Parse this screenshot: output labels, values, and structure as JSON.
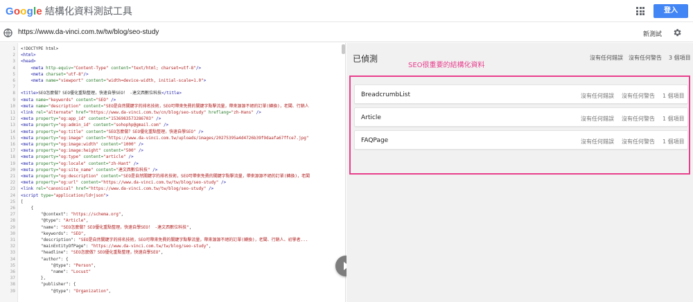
{
  "header": {
    "google_letters": [
      "G",
      "o",
      "o",
      "g",
      "l",
      "e"
    ],
    "tool_name": "結構化資料測試工具",
    "apps_icon": "apps-grid-icon",
    "signin_label": "登入"
  },
  "urlbar": {
    "globe_icon": "globe-icon",
    "url": "https://www.da-vinci.com.tw/tw/blog/seo-study",
    "new_test_label": "新測試",
    "settings_icon": "gear-icon"
  },
  "editor": {
    "lines": [
      {
        "n": "1",
        "parts": [
          [
            "p",
            "<!DOCTYPE html>"
          ]
        ]
      },
      {
        "n": "2",
        "parts": [
          [
            "t",
            "<html>"
          ]
        ]
      },
      {
        "n": "3",
        "parts": [
          [
            "t",
            "<head>"
          ]
        ]
      },
      {
        "n": "4",
        "parts": [
          [
            "p",
            "    "
          ],
          [
            "t",
            "<meta "
          ],
          [
            "a",
            "http-equiv="
          ],
          [
            "s",
            "\"Content-Type\""
          ],
          [
            "a",
            " content="
          ],
          [
            "s",
            "\"text/html; charset=utf-8\""
          ],
          [
            "t",
            "/>"
          ]
        ]
      },
      {
        "n": "5",
        "parts": [
          [
            "p",
            "    "
          ],
          [
            "t",
            "<meta "
          ],
          [
            "a",
            "charset="
          ],
          [
            "s",
            "\"utf-8\""
          ],
          [
            "t",
            "/>"
          ]
        ]
      },
      {
        "n": "6",
        "parts": [
          [
            "p",
            "    "
          ],
          [
            "t",
            "<meta "
          ],
          [
            "a",
            "name="
          ],
          [
            "s",
            "\"viewport\""
          ],
          [
            "a",
            " content="
          ],
          [
            "s",
            "\"width=device-width, initial-scale=1.0\""
          ],
          [
            "t",
            ">"
          ]
        ]
      },
      {
        "n": "7",
        "parts": [
          [
            "p",
            ""
          ]
        ]
      },
      {
        "n": "8",
        "parts": [
          [
            "t",
            "<title>"
          ],
          [
            "p",
            "SEO怎麼做？SEO優化重點整理，快速自學SEO！ -達文西數位科技"
          ],
          [
            "t",
            "</title>"
          ]
        ]
      },
      {
        "n": "9",
        "parts": [
          [
            "t",
            "<meta "
          ],
          [
            "a",
            "name="
          ],
          [
            "s",
            "\"keywords\""
          ],
          [
            "a",
            " content="
          ],
          [
            "s",
            "\"SEO\""
          ],
          [
            "t",
            " />"
          ]
        ]
      },
      {
        "n": "10",
        "parts": [
          [
            "t",
            "<meta "
          ],
          [
            "a",
            "name="
          ],
          [
            "s",
            "\"description\""
          ],
          [
            "a",
            " content="
          ],
          [
            "s",
            "\"SEO是自然關鍵字的排名技術，SEO可帶來免費的關鍵字點擊流量，帶來源源不絕的訂單(轉換)，老闆、行銷人"
          ]
        ]
      },
      {
        "n": "11",
        "parts": [
          [
            "t",
            "<link "
          ],
          [
            "a",
            "rel="
          ],
          [
            "s",
            "\"alternate\""
          ],
          [
            "a",
            " href="
          ],
          [
            "s",
            "\"https://www.da-vinci.com.tw/cn/blog/seo-study\""
          ],
          [
            "a",
            " hreflang="
          ],
          [
            "s",
            "\"zh-Hans\""
          ],
          [
            "t",
            " />"
          ]
        ]
      },
      {
        "n": "12",
        "parts": [
          [
            "t",
            "<meta "
          ],
          [
            "a",
            "property="
          ],
          [
            "s",
            "\"og:app_id\""
          ],
          [
            "a",
            " content="
          ],
          [
            "s",
            "\"1536983573286703\""
          ],
          [
            "t",
            " />"
          ]
        ]
      },
      {
        "n": "13",
        "parts": [
          [
            "t",
            "<meta "
          ],
          [
            "a",
            "property="
          ],
          [
            "s",
            "\"og:admin_id\""
          ],
          [
            "a",
            " content="
          ],
          [
            "s",
            "\"sohophp@gmail.com\""
          ],
          [
            "t",
            " />"
          ]
        ]
      },
      {
        "n": "14",
        "parts": [
          [
            "t",
            "<meta "
          ],
          [
            "a",
            "property="
          ],
          [
            "s",
            "\"og:title\""
          ],
          [
            "a",
            " content="
          ],
          [
            "s",
            "\"SEO怎麼做？SEO優化重點整理，快速自學SEO\""
          ],
          [
            "t",
            " />"
          ]
        ]
      },
      {
        "n": "15",
        "parts": [
          [
            "t",
            "<meta "
          ],
          [
            "a",
            "property="
          ],
          [
            "s",
            "\"og:image\""
          ],
          [
            "a",
            " content="
          ],
          [
            "s",
            "\"https://www.da-vinci.com.tw/uploads/images/20275395a4d4726b39f9daafa67ffce7.jpg\""
          ]
        ]
      },
      {
        "n": "16",
        "parts": [
          [
            "t",
            "<meta "
          ],
          [
            "a",
            "property="
          ],
          [
            "s",
            "\"og:image:width\""
          ],
          [
            "a",
            " content="
          ],
          [
            "s",
            "\"1000\""
          ],
          [
            "t",
            " />"
          ]
        ]
      },
      {
        "n": "17",
        "parts": [
          [
            "t",
            "<meta "
          ],
          [
            "a",
            "property="
          ],
          [
            "s",
            "\"og:image:height\""
          ],
          [
            "a",
            " content="
          ],
          [
            "s",
            "\"500\""
          ],
          [
            "t",
            " />"
          ]
        ]
      },
      {
        "n": "18",
        "parts": [
          [
            "t",
            "<meta "
          ],
          [
            "a",
            "property="
          ],
          [
            "s",
            "\"og:type\""
          ],
          [
            "a",
            " content="
          ],
          [
            "s",
            "\"article\""
          ],
          [
            "t",
            " />"
          ]
        ]
      },
      {
        "n": "19",
        "parts": [
          [
            "t",
            "<meta "
          ],
          [
            "a",
            "property="
          ],
          [
            "s",
            "\"og:locale\""
          ],
          [
            "a",
            " content="
          ],
          [
            "s",
            "\"zh-Hant\""
          ],
          [
            "t",
            " />"
          ]
        ]
      },
      {
        "n": "20",
        "parts": [
          [
            "t",
            "<meta "
          ],
          [
            "a",
            "property="
          ],
          [
            "s",
            "\"og:site_name\""
          ],
          [
            "a",
            " content="
          ],
          [
            "s",
            "\"達文西數位科技\""
          ],
          [
            "t",
            " />"
          ]
        ]
      },
      {
        "n": "21",
        "parts": [
          [
            "t",
            "<meta "
          ],
          [
            "a",
            "property="
          ],
          [
            "s",
            "\"og:description\""
          ],
          [
            "a",
            " content="
          ],
          [
            "s",
            "\"SEO是自然關鍵字的排名技術，SEO可帶來免費的關鍵字點擊流量，帶來源源不絕的訂單(轉換)，老闆"
          ]
        ]
      },
      {
        "n": "22",
        "parts": [
          [
            "t",
            "<meta "
          ],
          [
            "a",
            "property="
          ],
          [
            "s",
            "\"og:url\""
          ],
          [
            "a",
            " content="
          ],
          [
            "s",
            "\"https://www.da-vinci.com.tw/tw/blog/seo-study\""
          ],
          [
            "t",
            " />"
          ]
        ]
      },
      {
        "n": "23",
        "parts": [
          [
            "t",
            "<link "
          ],
          [
            "a",
            "rel="
          ],
          [
            "s",
            "\"canonical\""
          ],
          [
            "a",
            " href="
          ],
          [
            "s",
            "\"https://www.da-vinci.com.tw/tw/blog/seo-study\""
          ],
          [
            "t",
            " />"
          ]
        ]
      },
      {
        "n": "24",
        "parts": [
          [
            "t",
            "<script "
          ],
          [
            "a",
            "type="
          ],
          [
            "s",
            "\"application/ld+json\""
          ],
          [
            "t",
            ">"
          ]
        ]
      },
      {
        "n": "25",
        "parts": [
          [
            "p",
            "["
          ]
        ]
      },
      {
        "n": "26",
        "parts": [
          [
            "p",
            "    {"
          ]
        ]
      },
      {
        "n": "27",
        "parts": [
          [
            "p",
            "        \"@context\": "
          ],
          [
            "s",
            "\"https://schema.org\""
          ],
          [
            "p",
            ","
          ]
        ]
      },
      {
        "n": "28",
        "parts": [
          [
            "p",
            "        \"@type\": "
          ],
          [
            "s",
            "\"Article\""
          ],
          [
            "p",
            ","
          ]
        ]
      },
      {
        "n": "29",
        "parts": [
          [
            "p",
            "        \"name\": "
          ],
          [
            "s",
            "\"SEO怎麼做？SEO優化重點整理，快速自學SEO！ -達文西數位科技\""
          ],
          [
            "p",
            ","
          ]
        ]
      },
      {
        "n": "30",
        "parts": [
          [
            "p",
            "        \"keywords\": "
          ],
          [
            "s",
            "\"SEO\""
          ],
          [
            "p",
            ","
          ]
        ]
      },
      {
        "n": "31",
        "parts": [
          [
            "p",
            "        \"description\": "
          ],
          [
            "s",
            "\"SEO是自然關鍵字的排名技術，SEO可帶來免費的關鍵字點擊流量，帶來源源不絕的訂單(轉換)，老闆、行銷人、初學者..."
          ]
        ]
      },
      {
        "n": "32",
        "parts": [
          [
            "p",
            "        \"mainEntityOfPage\": "
          ],
          [
            "s",
            "\"https://www.da-vinci.com.tw/tw/blog/seo-study\""
          ],
          [
            "p",
            ","
          ]
        ]
      },
      {
        "n": "33",
        "parts": [
          [
            "p",
            "        \"headline\": "
          ],
          [
            "s",
            "\"SEO怎麼做？SEO優化重點整理，快速自學SEO\""
          ],
          [
            "p",
            ","
          ]
        ]
      },
      {
        "n": "34",
        "parts": [
          [
            "p",
            "        \"author\": {"
          ]
        ]
      },
      {
        "n": "35",
        "parts": [
          [
            "p",
            "            \"@type\": "
          ],
          [
            "s",
            "\"Person\""
          ],
          [
            "p",
            ","
          ]
        ]
      },
      {
        "n": "36",
        "parts": [
          [
            "p",
            "            \"name\": "
          ],
          [
            "s",
            "\"Locust\""
          ]
        ]
      },
      {
        "n": "37",
        "parts": [
          [
            "p",
            "        },"
          ]
        ]
      },
      {
        "n": "38",
        "parts": [
          [
            "p",
            "        \"publisher\": {"
          ]
        ]
      },
      {
        "n": "39",
        "parts": [
          [
            "p",
            "            \"@type\": "
          ],
          [
            "s",
            "\"Organization\""
          ],
          [
            "p",
            ","
          ]
        ]
      }
    ],
    "run_icon": "play-icon"
  },
  "results": {
    "title": "已偵測",
    "summary_errors": "沒有任何錯誤",
    "summary_warnings": "沒有任何警告",
    "summary_items": "3 個項目",
    "annotation": "SEO很重要的結構化資料",
    "highlight_color": "#e83e8c",
    "items": [
      {
        "name": "BreadcrumbList",
        "errors": "沒有任何錯誤",
        "warnings": "沒有任何警告",
        "items": "1 個項目"
      },
      {
        "name": "Article",
        "errors": "沒有任何錯誤",
        "warnings": "沒有任何警告",
        "items": "1 個項目"
      },
      {
        "name": "FAQPage",
        "errors": "沒有任何錯誤",
        "warnings": "沒有任何警告",
        "items": "1 個項目"
      }
    ]
  }
}
